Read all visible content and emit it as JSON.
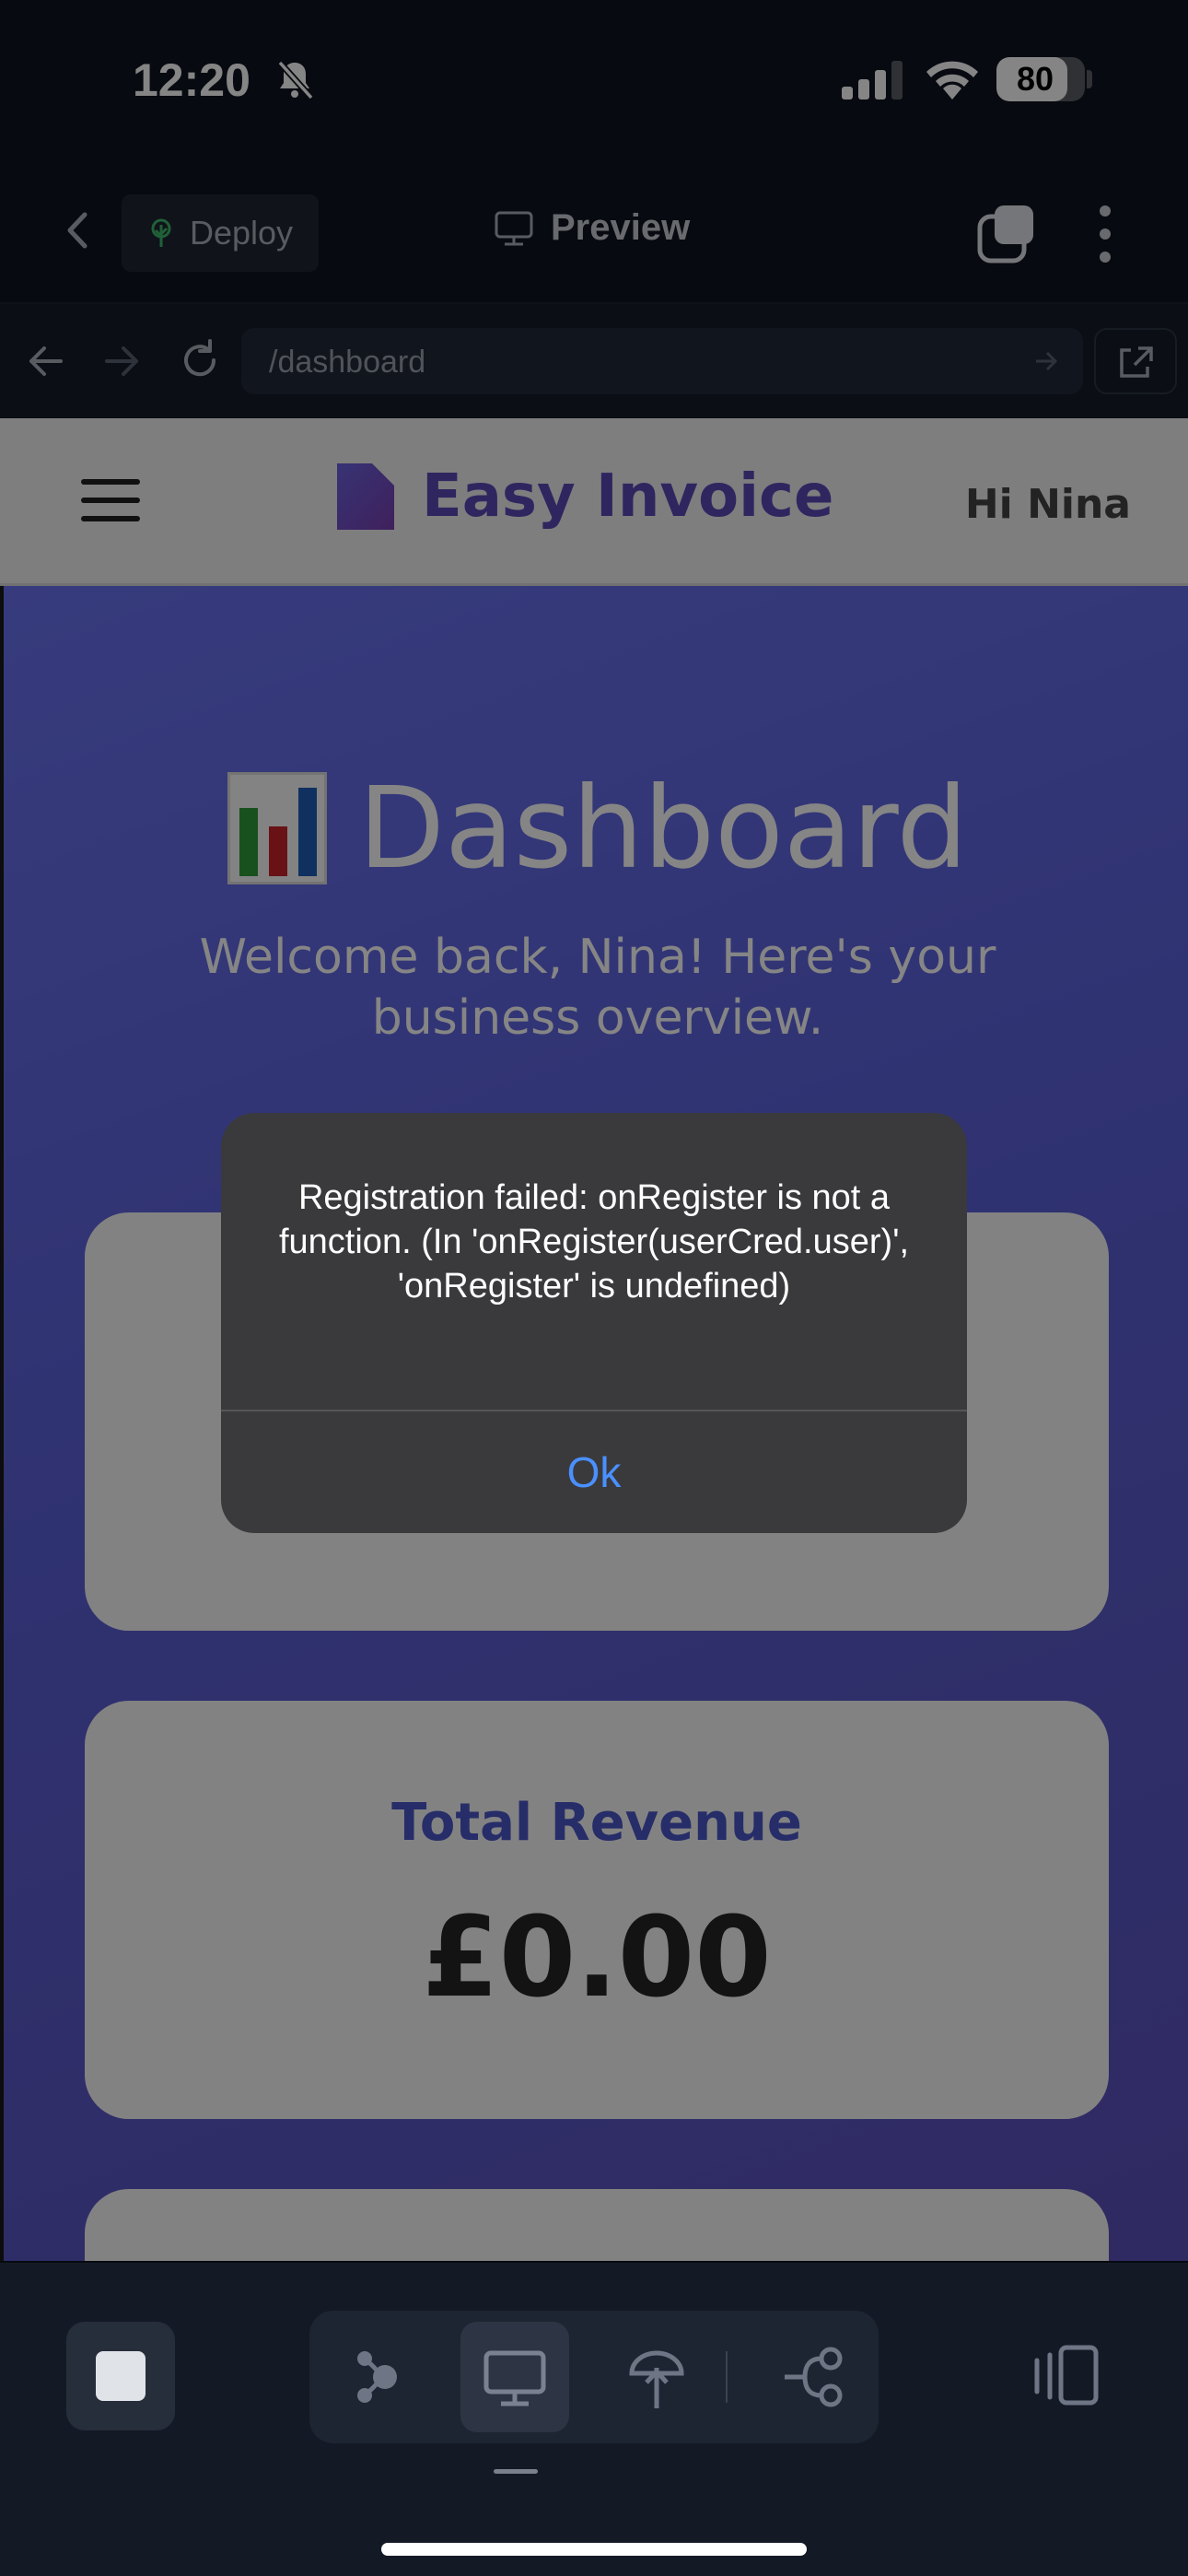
{
  "status_bar": {
    "time": "12:20",
    "battery": "80",
    "battery_level": 0.8
  },
  "topbar": {
    "deploy_label": "Deploy",
    "preview_label": "Preview"
  },
  "browser": {
    "url": "/dashboard"
  },
  "site": {
    "brand": "Easy Invoice",
    "greeting": "Hi Nina",
    "dashboard_title": "Dashboard",
    "welcome": "Welcome back, Nina! Here's your business overview.",
    "cards": [
      {
        "label": "Total Revenue",
        "value": "£0.00"
      }
    ]
  },
  "alert": {
    "message": "Registration failed: onRegister is not a function. (In 'onRegister(userCred.user)', 'onRegister' is undefined)",
    "ok_label": "Ok"
  },
  "colors": {
    "accent": "#4a90ff",
    "brand": "#5b4ab8",
    "hero_bg": "#5a5fd6"
  },
  "icons": [
    "bell-slash-icon",
    "signal-icon",
    "wifi-icon",
    "battery-icon",
    "chevron-left-icon",
    "tree-icon",
    "monitor-icon",
    "tabs-icon",
    "more-vertical-icon",
    "arrow-left-icon",
    "arrow-right-icon",
    "reload-icon",
    "external-link-icon",
    "hamburger-icon",
    "document-icon",
    "bar-chart-icon",
    "stop-icon",
    "agent-icon",
    "monitor-icon",
    "deploy-icon",
    "flow-icon",
    "device-toggle-icon"
  ]
}
